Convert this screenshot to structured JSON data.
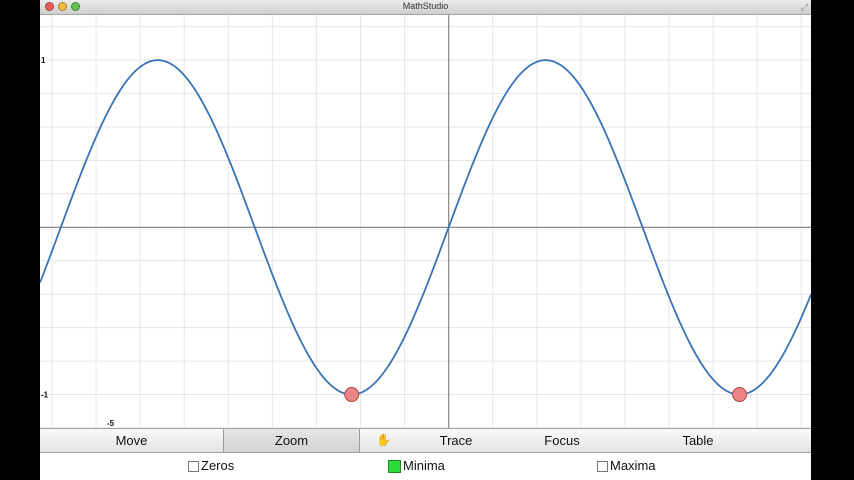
{
  "window": {
    "title": "MathStudio"
  },
  "chart_data": {
    "type": "line",
    "function": "sin(x)",
    "x": [
      -6.5,
      -6.0,
      -5.5,
      -5.0,
      -4.71,
      -4.5,
      -4.0,
      -3.5,
      -3.14,
      -3.0,
      -2.5,
      -2.0,
      -1.57,
      -1.5,
      -1.0,
      -0.5,
      0.0,
      0.5,
      1.0,
      1.5,
      1.57,
      2.0,
      2.5,
      3.0,
      3.14,
      3.5,
      4.0,
      4.5,
      4.71,
      5.0,
      5.5,
      6.0,
      6.5
    ],
    "y": [
      -0.215,
      0.279,
      0.706,
      0.959,
      1.0,
      0.978,
      0.757,
      0.351,
      0.0,
      -0.141,
      -0.598,
      -0.909,
      -1.0,
      -0.997,
      -0.841,
      -0.479,
      0.0,
      0.479,
      0.841,
      0.997,
      1.0,
      0.909,
      0.598,
      0.141,
      0.0,
      -0.351,
      -0.757,
      -0.978,
      -1.0,
      -0.959,
      -0.706,
      -0.279,
      0.215
    ],
    "xlim": [
      -6.62,
      5.87
    ],
    "ylim": [
      -1.2,
      1.27
    ],
    "minima_markers": [
      {
        "x": -1.5708,
        "y": -1
      },
      {
        "x": 4.7124,
        "y": -1
      }
    ],
    "tick_labels": {
      "y_top": "1",
      "y_bottom": "-1",
      "x_left": "-5"
    },
    "grid": true,
    "series_color": "#3a74b4",
    "marker_color": "#ec8585"
  },
  "toolbar": {
    "move": "Move",
    "zoom": "Zoom",
    "trace": "Trace",
    "focus": "Focus",
    "table": "Table",
    "active": "Zoom"
  },
  "options": {
    "zeros": {
      "label": "Zeros",
      "checked": false
    },
    "minima": {
      "label": "Minima",
      "checked": true
    },
    "maxima": {
      "label": "Maxima",
      "checked": false
    }
  },
  "icons": {
    "cursor": "hand-cursor-icon"
  }
}
